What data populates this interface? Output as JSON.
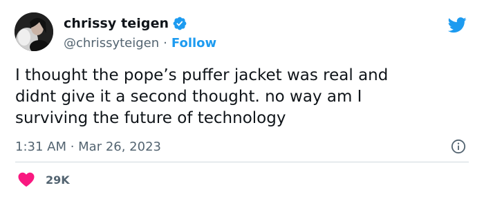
{
  "author": {
    "display_name": "chrissy teigen",
    "handle": "@chrissyteigen",
    "separator": "·",
    "follow_label": "Follow"
  },
  "tweet": {
    "text": "I thought the pope’s puffer jacket was real and\ndidnt give it a second thought. no way am I\nsurviving the future of technology",
    "timestamp": "1:31 AM · Mar 26, 2023",
    "likes": "29K"
  },
  "icons": {
    "verified": "verified-badge-icon",
    "brand": "twitter-bird-icon",
    "info": "info-icon",
    "like": "heart-icon"
  },
  "colors": {
    "accent": "#1d9bf0",
    "heart": "#f91880",
    "secondary_text": "#536471"
  }
}
